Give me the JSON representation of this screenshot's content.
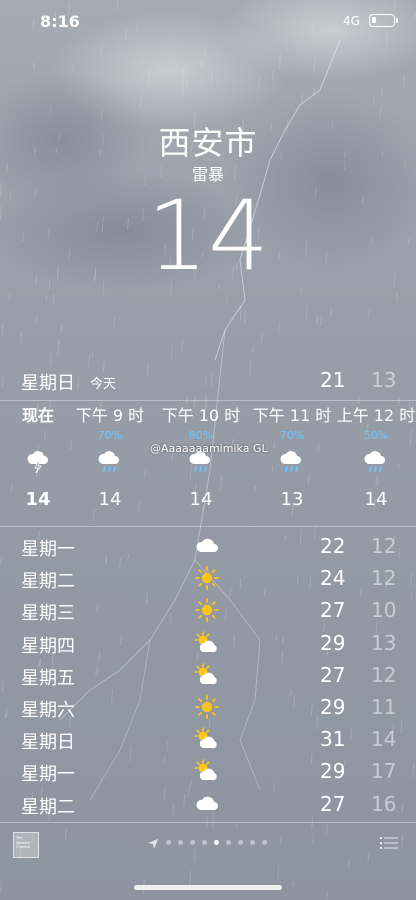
{
  "status_bar": {
    "time": "8:16",
    "network": "4G"
  },
  "location": {
    "city": "西安市",
    "condition": "雷暴",
    "temperature": "14"
  },
  "today": {
    "day": "星期日",
    "label": "今天",
    "high": "21",
    "low": "13"
  },
  "hourly": [
    {
      "label": "现在",
      "prob": "",
      "icon": "thunderstorm-icon",
      "temp": "14"
    },
    {
      "label": "下午 9 时",
      "prob": "70%",
      "icon": "rain-icon",
      "temp": "14"
    },
    {
      "label": "下午 10 时",
      "prob": "80%",
      "icon": "rain-icon",
      "temp": "14"
    },
    {
      "label": "下午 11 时",
      "prob": "70%",
      "icon": "rain-icon",
      "temp": "13"
    },
    {
      "label": "上午 12 时",
      "prob": "50%",
      "icon": "rain-icon",
      "temp": "14"
    }
  ],
  "watermark": "@Aaaaaaamimika GL",
  "daily": [
    {
      "day": "星期一",
      "icon": "cloud-icon",
      "high": "22",
      "low": "12"
    },
    {
      "day": "星期二",
      "icon": "sun-icon",
      "high": "24",
      "low": "12"
    },
    {
      "day": "星期三",
      "icon": "sun-icon",
      "high": "27",
      "low": "10"
    },
    {
      "day": "星期四",
      "icon": "partly-cloudy-icon",
      "high": "29",
      "low": "13"
    },
    {
      "day": "星期五",
      "icon": "partly-cloudy-icon",
      "high": "27",
      "low": "12"
    },
    {
      "day": "星期六",
      "icon": "sun-icon",
      "high": "29",
      "low": "11"
    },
    {
      "day": "星期日",
      "icon": "partly-cloudy-icon",
      "high": "31",
      "low": "14"
    },
    {
      "day": "星期一",
      "icon": "partly-cloudy-icon",
      "high": "29",
      "low": "17"
    },
    {
      "day": "星期二",
      "icon": "cloud-icon",
      "high": "27",
      "low": "16"
    }
  ],
  "bottom_bar": {
    "logo_text": "The Weather Channel",
    "page_count": 9,
    "active_page": 4
  },
  "colors": {
    "probability": "#6cc4ff",
    "sun": "#ffc61a",
    "background": "#9aa0a9"
  }
}
